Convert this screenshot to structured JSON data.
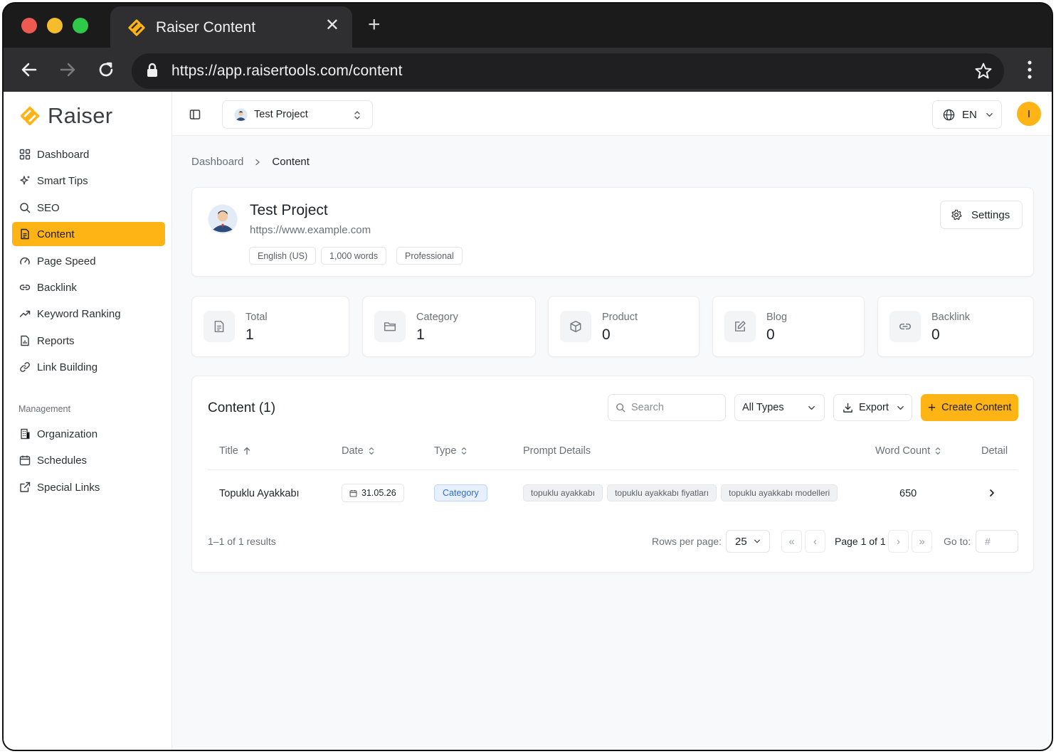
{
  "browser": {
    "tab_title": "Raiser Content",
    "url": "https://app.raisertools.com/content",
    "traffic_lights": [
      "#ee5a52",
      "#f5bd2e",
      "#2fc94a"
    ]
  },
  "brand": {
    "name": "Raiser",
    "accent": "#fdb414"
  },
  "sidebar": {
    "items": [
      {
        "label": "Dashboard",
        "icon": "grid-icon"
      },
      {
        "label": "Smart Tips",
        "icon": "sparkles-icon"
      },
      {
        "label": "SEO",
        "icon": "search-icon"
      },
      {
        "label": "Content",
        "icon": "document-icon",
        "active": true
      },
      {
        "label": "Page Speed",
        "icon": "gauge-icon"
      },
      {
        "label": "Backlink",
        "icon": "link-icon"
      },
      {
        "label": "Keyword Ranking",
        "icon": "trend-icon"
      },
      {
        "label": "Reports",
        "icon": "report-icon"
      },
      {
        "label": "Link Building",
        "icon": "chain-icon"
      }
    ],
    "section_label": "Management",
    "management": [
      {
        "label": "Organization",
        "icon": "building-icon"
      },
      {
        "label": "Schedules",
        "icon": "calendar-icon"
      },
      {
        "label": "Special Links",
        "icon": "external-link-icon"
      }
    ]
  },
  "topbar": {
    "project": "Test Project",
    "language": "EN",
    "avatar_initial": "I"
  },
  "breadcrumb": {
    "parent": "Dashboard",
    "current": "Content"
  },
  "project": {
    "title": "Test Project",
    "url": "https://www.example.com",
    "chips": [
      "English (US)",
      "1,000 words",
      "Professional"
    ],
    "settings_label": "Settings"
  },
  "stats": [
    {
      "label": "Total",
      "value": "1",
      "icon": "file-icon"
    },
    {
      "label": "Category",
      "value": "1",
      "icon": "folder-icon"
    },
    {
      "label": "Product",
      "value": "0",
      "icon": "box-icon"
    },
    {
      "label": "Blog",
      "value": "0",
      "icon": "edit-icon"
    },
    {
      "label": "Backlink",
      "value": "0",
      "icon": "link-icon"
    }
  ],
  "content": {
    "title": "Content (1)",
    "search_placeholder": "Search",
    "type_filter": "All Types",
    "export_label": "Export",
    "create_label": "Create Content",
    "columns": [
      "Title",
      "Date",
      "Type",
      "Prompt Details",
      "Word Count",
      "Detail"
    ],
    "rows": [
      {
        "title": "Topuklu Ayakkabı",
        "date": "31.05.26",
        "type": "Category",
        "keywords": [
          "topuklu ayakkabı",
          "topuklu ayakkabı fiyatları",
          "topuklu ayakkabı modelleri"
        ],
        "word_count": "650"
      }
    ],
    "results_text": "1–1 of 1 results",
    "rows_per_page_label": "Rows per page:",
    "rows_per_page": "25",
    "page_text": "Page 1 of 1",
    "goto_label": "Go to:",
    "goto_placeholder": "#"
  }
}
